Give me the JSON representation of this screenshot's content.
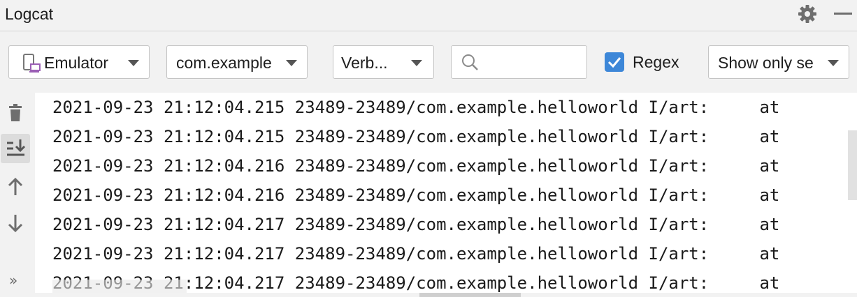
{
  "window": {
    "title": "Logcat"
  },
  "toolbar": {
    "device": "Emulator",
    "process": "com.example",
    "level": "Verb...",
    "search_placeholder": "",
    "regex_label": "Regex",
    "regex_checked": true,
    "filter": "Show only se"
  },
  "icons": {
    "settings": "gear-icon",
    "minimize": "minimize-icon",
    "device": "device-icon",
    "search": "search-icon",
    "clear": "trash-icon",
    "scroll_to_end": "scroll-to-end-icon",
    "up": "arrow-up-icon",
    "down": "arrow-down-icon",
    "more": "chevron-double-right-icon"
  },
  "sidebar": {
    "more_label": "»"
  },
  "log": {
    "lines": [
      "2021-09-23 21:12:04.215 23489-23489/com.example.helloworld I/art:     at",
      "2021-09-23 21:12:04.215 23489-23489/com.example.helloworld I/art:     at",
      "2021-09-23 21:12:04.216 23489-23489/com.example.helloworld I/art:     at",
      "2021-09-23 21:12:04.216 23489-23489/com.example.helloworld I/art:     at",
      "2021-09-23 21:12:04.217 23489-23489/com.example.helloworld I/art:     at",
      "2021-09-23 21:12:04.217 23489-23489/com.example.helloworld I/art:     at",
      "2021-09-23 21:12:04.217 23489-23489/com.example.helloworld I/art:     at"
    ]
  },
  "colors": {
    "accent": "#3d87d8",
    "background": "#f2f2f2",
    "log_background": "#ffffff"
  }
}
